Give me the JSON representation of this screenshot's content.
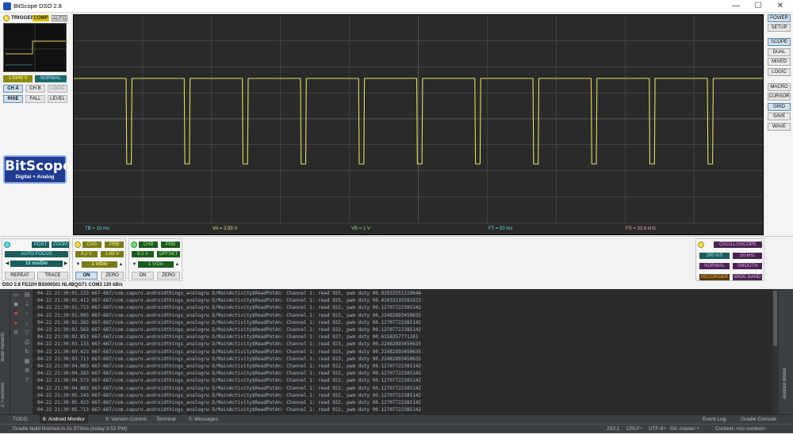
{
  "window": {
    "title": "BitScope DSO 2.8",
    "minimize": "—",
    "maximize": "☐",
    "close": "✕"
  },
  "trigger": {
    "title": "TRIGGER",
    "comp": "COMP",
    "auto": "AUTO",
    "level_readout": "1.6349 V",
    "mode": "NORMAL",
    "sources": [
      "CH A",
      "CH B",
      "LOGIC"
    ],
    "edges": [
      "RISE",
      "FALL",
      "LEVEL"
    ]
  },
  "brand": {
    "name": "BitScope",
    "tagline": "Digital + Analog"
  },
  "scope": {
    "measurements": {
      "tb": "TB = 10 ms",
      "va": "VA = 2.93 V",
      "vb": "VB = 1 V",
      "ft": "FT = 50 ms",
      "fs": "FS = 33.6 kHz"
    },
    "colors": {
      "trace": "#dede5a",
      "grid": "#5a5a5a",
      "background": "#2a2a2a"
    }
  },
  "right_menu": [
    "POWER",
    "SETUP",
    "SCOPE",
    "DUAL",
    "MIXED",
    "LOGIC",
    "MACRO",
    "CURSOR",
    "GRID",
    "SAVE",
    "WAVE"
  ],
  "timebase": {
    "post": "POST",
    "zoom": "ZOOM",
    "autofocus": "AUTO FOCUS",
    "value": "10 ms/Div",
    "repeat": "REPEAT",
    "trace": "TRACE"
  },
  "channel_a": {
    "cha": "CHA",
    "prb": "PRB",
    "v1": "9.2 V",
    "v2": "1.63 V",
    "scale": "1 V/Div",
    "on": "ON",
    "zero": "ZERO"
  },
  "channel_b": {
    "chb": "CHB",
    "prb": "PRB",
    "v1": "9.2 V",
    "offset": "OFFSET",
    "scale": "1 V/Div",
    "on": "ON",
    "zero": "ZERO"
  },
  "display_mode": {
    "title": "OSCILLOSCOPE",
    "rate": "200 mS",
    "freq": "50 kHz",
    "normal": "NORMAL",
    "smooth": "SMOOTH",
    "recorder": "RECORDER",
    "wideband": "WIDE BAND"
  },
  "status_line": "DSO 2.8 FE22H BS000501 NL4BQG71 COM3 120 kB/s",
  "ide": {
    "left_tabs": [
      "Build Variants",
      "2: Favorites"
    ],
    "right_tab": "Android Model",
    "log_lines": [
      "04-22 21:30:01.133 667-667/com.capuro.androidthings_analogrw D/MainActivity$ReadPotAn: Channel 1: read 925, pwm duty 90.02932551319648",
      "04-22 21:30:01.413 667-667/com.capuro.androidthings_analogrw D/MainActivity$ReadPotAn: Channel 1: read 925, pwm duty 90.42033235581623",
      "04-22 21:30:01.713 667-667/com.capuro.androidthings_analogrw D/MainActivity$ReadPotAn: Channel 1: read 922, pwm duty 90.12707722385142",
      "04-22 21:30:01.993 667-667/com.capuro.androidthings_analogrw D/MainActivity$ReadPotAn: Channel 1: read 923, pwm duty 90.22482893450635",
      "04-22 21:30:02.283 667-667/com.capuro.androidthings_analogrw D/MainActivity$ReadPotAn: Channel 1: read 922, pwm duty 90.12707722385142",
      "04-22 21:30:02.563 667-667/com.capuro.androidthings_analogrw D/MainActivity$ReadPotAn: Channel 1: read 922, pwm duty 90.12707722385142",
      "04-22 21:30:02.853 667-667/com.capuro.androidthings_analogrw D/MainActivity$ReadPotAn: Channel 1: read 927, pwm duty 90.6158357771261",
      "04-22 21:30:03.133 667-667/com.capuro.androidthings_analogrw D/MainActivity$ReadPotAn: Channel 1: read 923, pwm duty 90.22482893450635",
      "04-22 21:30:03.423 667-667/com.capuro.androidthings_analogrw D/MainActivity$ReadPotAn: Channel 1: read 923, pwm duty 90.22482893450635",
      "04-22 21:30:03.713 667-667/com.capuro.androidthings_analogrw D/MainActivity$ReadPotAn: Channel 1: read 923, pwm duty 90.22482893450635",
      "04-22 21:30:04.003 667-667/com.capuro.androidthings_analogrw D/MainActivity$ReadPotAn: Channel 1: read 922, pwm duty 90.12707722385142",
      "04-22 21:30:04.283 667-667/com.capuro.androidthings_analogrw D/MainActivity$ReadPotAn: Channel 1: read 922, pwm duty 90.12707722385142",
      "04-22 21:30:04.573 667-667/com.capuro.androidthings_analogrw D/MainActivity$ReadPotAn: Channel 1: read 922, pwm duty 90.12707722385142",
      "04-22 21:30:04.863 667-667/com.capuro.androidthings_analogrw D/MainActivity$ReadPotAn: Channel 1: read 922, pwm duty 90.12707722385142",
      "04-22 21:30:05.143 667-667/com.capuro.androidthings_analogrw D/MainActivity$ReadPotAn: Channel 1: read 922, pwm duty 90.12707722385142",
      "04-22 21:30:05.423 667-667/com.capuro.androidthings_analogrw D/MainActivity$ReadPotAn: Channel 1: read 922, pwm duty 90.12707722385142",
      "04-22 21:30:05.713 667-667/com.capuro.androidthings_analogrw D/MainActivity$ReadPotAn: Channel 1: read 922, pwm duty 90.12707722385142"
    ],
    "tool_tabs": {
      "todo": "TODO",
      "monitor": "6: Android Monitor",
      "vcs": "9: Version Control",
      "terminal": "Terminal",
      "messages": "0: Messages",
      "event_log": "Event Log",
      "gradle_console": "Gradle Console"
    },
    "status": {
      "message": "Gradle build finished in 2s 973ms (today 3:52 PM)",
      "position": "252:1",
      "line_sep": "CRLF÷",
      "encoding": "UTF-8÷",
      "git": "Git: master ÷",
      "context": "Context: <no context>"
    }
  }
}
